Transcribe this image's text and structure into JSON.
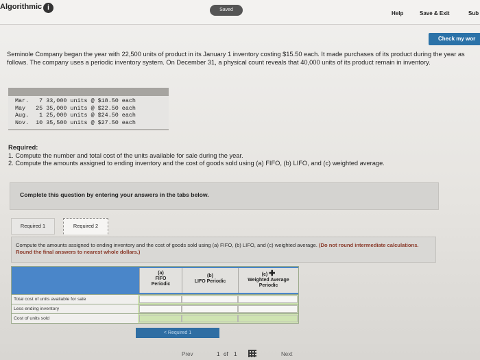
{
  "topbar": {
    "brand": "Algorithmic",
    "info_glyph": "i",
    "saved": "Saved",
    "help": "Help",
    "save_exit": "Save & Exit",
    "submit": "Sub"
  },
  "check_button": "Check my wor",
  "intro": "Seminole Company began the year with 22,500 units of product in its January 1 inventory costing $15.50 each. It made purchases of its product during the year as follows. The company uses a periodic inventory system. On December 31, a physical count reveals that 40,000 units of its product remain in inventory.",
  "purchases": [
    "Mar.   7 33,000 units @ $18.50 each",
    "May   25 35,000 units @ $22.50 each",
    "Aug.   1 25,000 units @ $24.50 each",
    "Nov.  10 35,500 units @ $27.50 each"
  ],
  "required": {
    "heading": "Required:",
    "item1": "1. Compute the number and total cost of the units available for sale during the year.",
    "item2": "2. Compute the amounts assigned to ending inventory and the cost of goods sold using (a) FIFO, (b) LIFO, and (c) weighted average."
  },
  "complete_box": "Complete this question by entering your answers in the tabs below.",
  "tabs": [
    {
      "label": "Required 1"
    },
    {
      "label": "Required 2"
    }
  ],
  "instructions": {
    "text": "Compute the amounts assigned to ending inventory and the cost of goods sold using (a) FIFO, (b) LIFO, and (c) weighted average.",
    "note": "(Do not round intermediate calculations. Round the final answers to nearest whole dollars.)"
  },
  "table": {
    "columns": [
      {
        "line1": "(a)",
        "line2": "FIFO",
        "line3": "Periodic"
      },
      {
        "line1": "(b)",
        "line2": "LIFO Periodic",
        "line3": ""
      },
      {
        "line1": "(c)",
        "line2": "Weighted Average",
        "line3": "Periodic"
      }
    ],
    "rows": [
      {
        "label": "Total cost of units available for sale"
      },
      {
        "label": "Less ending inventory"
      },
      {
        "label": "Cost of units sold"
      }
    ]
  },
  "nav": {
    "required_button": "< Required 1",
    "prev": "Prev",
    "page_current": "1",
    "page_of": "of",
    "page_total": "1",
    "next": "Next"
  },
  "colors": {
    "accent_blue": "#2b72a8",
    "table_header_blue": "#4a86c9",
    "answer_green": "#cfe4b2"
  }
}
